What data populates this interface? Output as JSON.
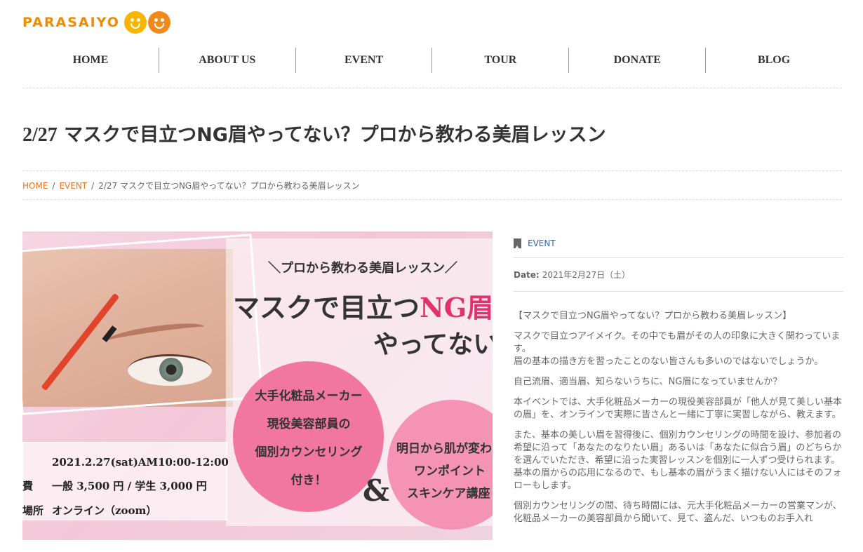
{
  "logo": {
    "text": "PARASAIYO"
  },
  "nav": [
    {
      "label": "HOME"
    },
    {
      "label": "ABOUT US"
    },
    {
      "label": "EVENT"
    },
    {
      "label": "TOUR"
    },
    {
      "label": "DONATE"
    },
    {
      "label": "BLOG"
    }
  ],
  "page": {
    "title_date": "2/27",
    "title_text": " マスクで目立つNG眉やってない？プロから教わる美眉レッスン"
  },
  "breadcrumb": {
    "home": "HOME",
    "separator": "/",
    "event": "EVENT",
    "current": "2/27 マスクで目立つNG眉やってない？プロから教わる美眉レッスン"
  },
  "hero": {
    "subtitle": "＼プロから教わる美眉レッスン／",
    "main_prefix": "マスクで目立つ",
    "main_ng": "NG眉",
    "main_line2": "やってない",
    "circle1": [
      "大手化粧品メーカー",
      "現役美容部員の",
      "個別カウンセリング",
      "付き！"
    ],
    "circle2": [
      "明日から肌が変わ",
      "ワンポイント",
      "スキンケア講座"
    ],
    "amp": "&",
    "info_date": "2021.2.27(sat)AM10:00-12:00",
    "info_fee_label": "費",
    "info_fee": "一般 3,500 円 / 学生 3,000 円",
    "info_place_label": "場所",
    "info_place": "オンライン（zoom）"
  },
  "side": {
    "category": "EVENT",
    "date_label": "Date:",
    "date_value": "2021年2月27日（土）",
    "paragraphs": [
      "【マスクで目立つNG眉やってない？プロから教わる美眉レッスン】",
      "マスクで目立つアイメイク。その中でも眉がその人の印象に大きく関わっています。\n眉の基本の描き方を習ったことのない皆さんも多いのではないでしょうか。",
      "自己流眉、適当眉、知らないうちに、NG眉になっていませんか？",
      "本イベントでは、大手化粧品メーカーの現役美容部員が「他人が見て美しい基本の眉」を、オンラインで実際に皆さんと一緒に丁寧に実習しながら、教えます。",
      "また、基本の美しい眉を習得後に、個別カウンセリングの時間を設け、参加者の希望に沿って「あなたのなりたい眉」あるいは「あなたに似合う眉」のどちらかを選んでいただき、希望に沿った実習レッスンを個別に一人ずつ受けられます。基本の眉からの応用になるので、もし基本の眉がうまく描けない人にはそのフォローもします。",
      "個別カウンセリングの間、待ち時間には、元大手化粧品メーカーの営業マンが、化粧品メーカーの美容部員から聞いて、見て、盗んだ、いつものお手入れ"
    ]
  }
}
